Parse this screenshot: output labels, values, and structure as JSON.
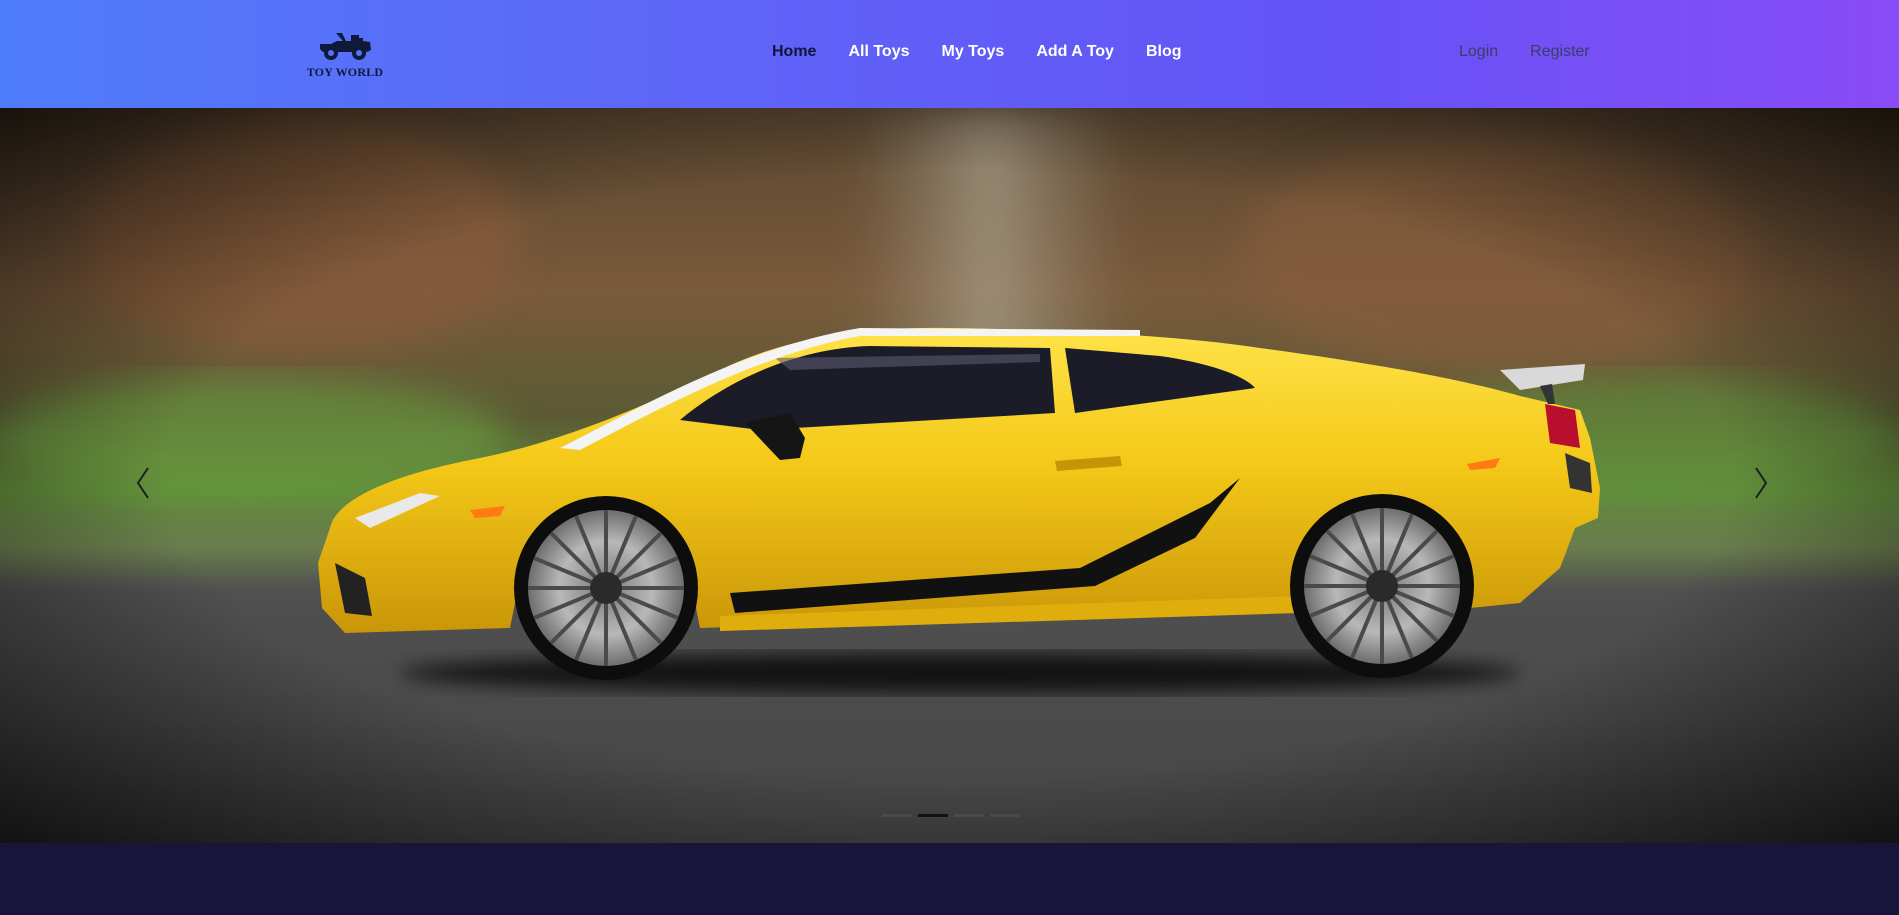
{
  "brand": {
    "name": "TOY WORLD",
    "logo_icon": "toy-jeep-icon"
  },
  "nav": {
    "items": [
      {
        "label": "Home",
        "active": true
      },
      {
        "label": "All Toys",
        "active": false
      },
      {
        "label": "My Toys",
        "active": false
      },
      {
        "label": "Add A Toy",
        "active": false
      },
      {
        "label": "Blog",
        "active": false
      }
    ]
  },
  "auth": {
    "login_label": "Login",
    "register_label": "Register"
  },
  "carousel": {
    "slide_count": 4,
    "active_slide": 2,
    "image_description_icon": "yellow-sports-car-image",
    "prev_icon": "chevron-left-icon",
    "next_icon": "chevron-right-icon"
  },
  "colors": {
    "header_gradient_start": "#4f7cfb",
    "header_gradient_end": "#8a4cf7",
    "page_background": "#17163a",
    "nav_active": "#14133a",
    "nav_text": "#ffffff"
  }
}
